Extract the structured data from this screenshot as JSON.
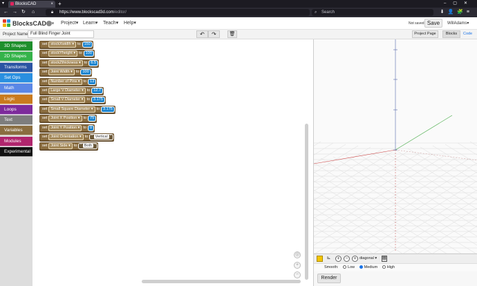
{
  "browser": {
    "tab_title": "BlocksCAD",
    "tab_close": "×",
    "new_tab": "+",
    "url_host": "https://www.blockscad3d.com",
    "url_path": "/editor/",
    "search_placeholder": "Search"
  },
  "header": {
    "logo_text": "BlocksCAD",
    "menus": [
      "Project",
      "Learn",
      "Teach",
      "Help"
    ],
    "status": "Not saved",
    "save_label": "Save",
    "user": "WillAdams"
  },
  "toolbar": {
    "project_label": "Project Name",
    "project_name": "Full Blind Finger Joint",
    "project_page": "Project Page",
    "blocks_tab": "Blocks",
    "code_tab": "Code"
  },
  "categories": [
    {
      "label": "3D Shapes",
      "color": "#1e8f2c"
    },
    {
      "label": "2D Shapes",
      "color": "#35b34a"
    },
    {
      "label": "Transforms",
      "color": "#2b54a3"
    },
    {
      "label": "Set Ops",
      "color": "#2a8fe0"
    },
    {
      "label": "Math",
      "color": "#5a87e6"
    },
    {
      "label": "Logic",
      "color": "#c97a1e"
    },
    {
      "label": "Loops",
      "color": "#7d2b9c"
    },
    {
      "label": "Text",
      "color": "#7d7d7d"
    },
    {
      "label": "Variables",
      "color": "#8a6d40"
    },
    {
      "label": "Modules",
      "color": "#b0256d"
    },
    {
      "label": "Experimental",
      "color": "#111111"
    }
  ],
  "blocks": [
    {
      "set": "set",
      "var": "stockXwidth",
      "to": "to",
      "value": "150"
    },
    {
      "set": "set",
      "var": "stockYheight",
      "to": "to",
      "value": "100"
    },
    {
      "set": "set",
      "var": "stockZthickness",
      "to": "to",
      "value": "6.5"
    },
    {
      "set": "set",
      "var": "Joint Width",
      "to": "to",
      "value": "100"
    },
    {
      "set": "set",
      "var": "Number of Pins",
      "to": "to",
      "value": "13"
    },
    {
      "set": "set",
      "var": "Large V Diameter",
      "to": "to",
      "value": "12.7"
    },
    {
      "set": "set",
      "var": "Small V Diameter",
      "to": "to",
      "value": "3.175"
    },
    {
      "set": "set",
      "var": "Small Square Diameter",
      "to": "to",
      "value": "3.175"
    },
    {
      "set": "set",
      "var": "Joint X Position",
      "to": "to",
      "value": "75"
    },
    {
      "set": "set",
      "var": "Joint Y Position",
      "to": "to",
      "value": "0"
    },
    {
      "set": "set",
      "var": "Joint Orientation",
      "to": "to",
      "value": "Vertical",
      "string": true
    },
    {
      "set": "set",
      "var": "Joint Side",
      "to": "to",
      "value": "Both",
      "string": true
    }
  ],
  "render": {
    "view": "diagonal",
    "smooth_label": "Smooth:",
    "smooth_options": [
      "Low",
      "Medium",
      "High"
    ],
    "smooth_selected": "Medium",
    "render_label": "Render"
  }
}
